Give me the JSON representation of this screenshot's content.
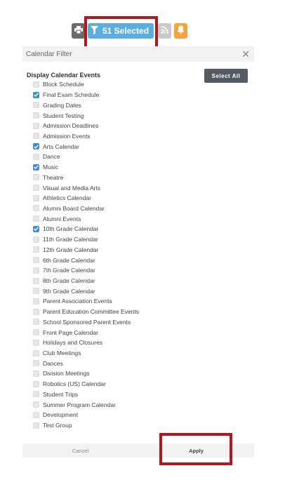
{
  "toolbar": {
    "filter_label": "51 Selected",
    "icons": [
      "print-icon",
      "filter-icon",
      "rss-icon",
      "bell-icon"
    ],
    "colors": {
      "filter": "#5aaee0",
      "print": "#6b6b6b",
      "rss": "#c9c9c9",
      "bell": "#f4a43a",
      "highlight": "#b3171d"
    }
  },
  "dialog": {
    "title": "Calendar Filter",
    "section_title": "Display Calendar Events",
    "select_all_label": "Select All",
    "items": [
      {
        "label": "Block Schedule",
        "checked": false
      },
      {
        "label": "Final Exam Schedule",
        "checked": true
      },
      {
        "label": "Grading Dates",
        "checked": false
      },
      {
        "label": "Student Testing",
        "checked": false
      },
      {
        "label": "Admission Deadlines",
        "checked": false
      },
      {
        "label": "Admission Events",
        "checked": false
      },
      {
        "label": "Arts Calendar",
        "checked": true
      },
      {
        "label": "Dance",
        "checked": false
      },
      {
        "label": "Music",
        "checked": true
      },
      {
        "label": "Theatre",
        "checked": false
      },
      {
        "label": "Visual and Media Arts",
        "checked": false
      },
      {
        "label": "Athletics Calendar",
        "checked": false
      },
      {
        "label": "Alumni Board Calendar",
        "checked": false
      },
      {
        "label": "Alumni Events",
        "checked": false
      },
      {
        "label": "10th Grade Calendar",
        "checked": true
      },
      {
        "label": "11th Grade Calendar",
        "checked": false
      },
      {
        "label": "12th Grade Calendar",
        "checked": false
      },
      {
        "label": "6th Grade Calendar",
        "checked": false
      },
      {
        "label": "7th Grade Calendar",
        "checked": false
      },
      {
        "label": "8th Grade Calendar",
        "checked": false
      },
      {
        "label": "9th Grade Calendar",
        "checked": false
      },
      {
        "label": "Parent Association Events",
        "checked": false
      },
      {
        "label": "Parent Education Committee Events",
        "checked": false
      },
      {
        "label": "School Sponsored Parent Events",
        "checked": false
      },
      {
        "label": "Front Page Calendar",
        "checked": false
      },
      {
        "label": "Holidays and Closures",
        "checked": false
      },
      {
        "label": "Club Meetings",
        "checked": false
      },
      {
        "label": "Dances",
        "checked": false
      },
      {
        "label": "Division Meetings",
        "checked": false
      },
      {
        "label": "Robotics (US) Calendar",
        "checked": false
      },
      {
        "label": "Student Trips",
        "checked": false
      },
      {
        "label": "Summer Program Calendar",
        "checked": false
      },
      {
        "label": "Development",
        "checked": false
      },
      {
        "label": "Test Group",
        "checked": false
      }
    ],
    "cancel_label": "Cancel",
    "apply_label": "Apply"
  }
}
